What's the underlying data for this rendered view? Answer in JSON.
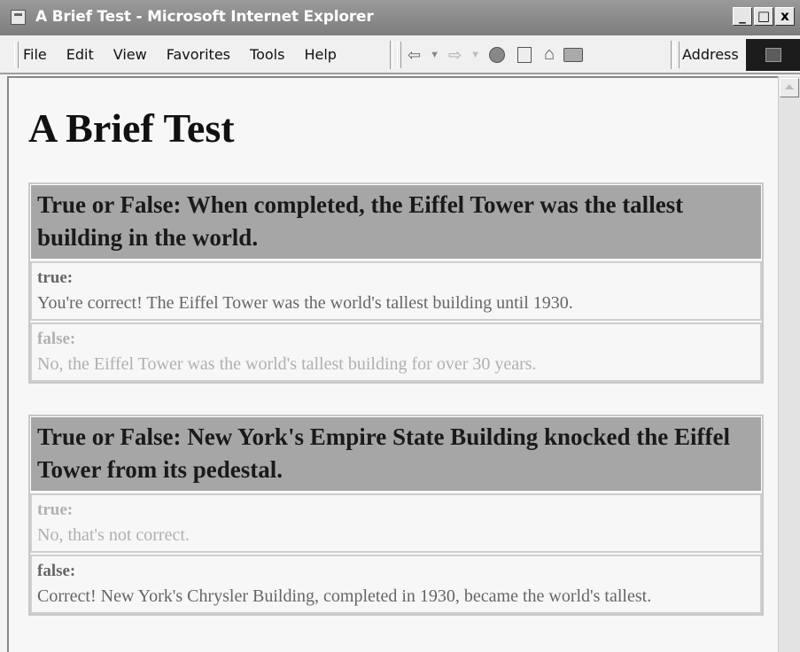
{
  "window": {
    "title": "A Brief Test - Microsoft Internet Explorer",
    "buttons": {
      "minimize": "_",
      "maximize": "□",
      "close": "x"
    }
  },
  "menu": [
    "File",
    "Edit",
    "View",
    "Favorites",
    "Tools",
    "Help"
  ],
  "toolbar": {
    "address_label": "Address",
    "icons": [
      "back-icon",
      "dropdown-icon",
      "forward-icon",
      "dropdown-icon",
      "stop-icon",
      "refresh-icon",
      "home-icon",
      "print-icon"
    ]
  },
  "page": {
    "title": "A Brief Test",
    "questions": [
      {
        "text": "True or False: When completed, the Eiffel Tower was the tallest building in the world.",
        "answers": [
          {
            "label": "true:",
            "text": "You're correct! The Eiffel Tower was the world's tallest building until 1930.",
            "state": "highlighted"
          },
          {
            "label": "false:",
            "text": "No, the Eiffel Tower was the world's tallest building for over 30 years.",
            "state": "faded"
          }
        ]
      },
      {
        "text": "True or False: New York's Empire State Building knocked the Eiffel Tower from its pedestal.",
        "answers": [
          {
            "label": "true:",
            "text": "No, that's not correct.",
            "state": "faded"
          },
          {
            "label": "false:",
            "text": "Correct! New York's Chrysler Building, completed in 1930, became the world's tallest.",
            "state": "highlighted"
          }
        ]
      }
    ]
  },
  "colors": {
    "question_header_bg": "#a6a6a6",
    "answer_highlighted_text": "#666666",
    "answer_faded_text": "#b0b0b0"
  }
}
